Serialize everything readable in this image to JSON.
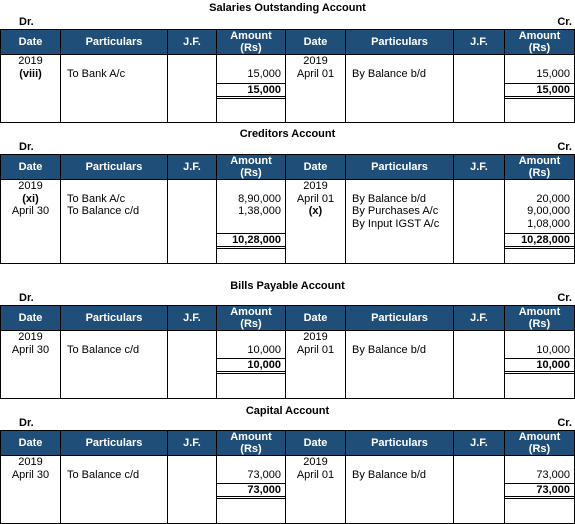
{
  "labels": {
    "dr": "Dr.",
    "cr": "Cr."
  },
  "columns": {
    "date": "Date",
    "particulars": "Particulars",
    "jf": "J.F.",
    "amount_1": "Amount",
    "amount_2": "(Rs)"
  },
  "accounts": [
    {
      "title": "Salaries  Outstanding Account",
      "debit": {
        "date": [
          "2019",
          "(viii)"
        ],
        "date_bold": [
          false,
          true
        ],
        "particulars": [
          "",
          "To Bank A/c"
        ],
        "amounts": [
          "",
          "15,000"
        ],
        "total": "15,000"
      },
      "credit": {
        "date": [
          "2019",
          "April 01"
        ],
        "date_bold": [
          false,
          false
        ],
        "particulars": [
          "",
          "By Balance b/d"
        ],
        "amounts": [
          "",
          "15,000"
        ],
        "total": "15,000"
      }
    },
    {
      "title": "Creditors Account",
      "debit": {
        "date": [
          "2019",
          "(xi)",
          "April 30"
        ],
        "date_bold": [
          false,
          true,
          false
        ],
        "particulars": [
          "",
          "To Bank A/c",
          "To Balance c/d"
        ],
        "amounts": [
          "",
          "8,90,000",
          "1,38,000"
        ],
        "total": "10,28,000"
      },
      "credit": {
        "date": [
          "2019",
          "April 01",
          "(x)"
        ],
        "date_bold": [
          false,
          false,
          true
        ],
        "particulars": [
          "",
          "By Balance b/d",
          "By Purchases A/c",
          "By Input IGST A/c"
        ],
        "amounts": [
          "",
          "20,000",
          "9,00,000",
          "1,08,000"
        ],
        "total": "10,28,000"
      }
    },
    {
      "title": "Bills Payable  Account",
      "debit": {
        "date": [
          "2019",
          "April 30"
        ],
        "date_bold": [
          false,
          false
        ],
        "particulars": [
          "",
          "To Balance c/d"
        ],
        "amounts": [
          "",
          "10,000"
        ],
        "total": "10,000"
      },
      "credit": {
        "date": [
          "2019",
          "April 01"
        ],
        "date_bold": [
          false,
          false
        ],
        "particulars": [
          "",
          "By Balance b/d"
        ],
        "amounts": [
          "",
          "10,000"
        ],
        "total": "10,000"
      }
    },
    {
      "title": "Capital Account",
      "debit": {
        "date": [
          "2019",
          "April 30"
        ],
        "date_bold": [
          false,
          false
        ],
        "particulars": [
          "",
          "To Balance c/d"
        ],
        "amounts": [
          "",
          "73,000"
        ],
        "total": "73,000"
      },
      "credit": {
        "date": [
          "2019",
          "April 01"
        ],
        "date_bold": [
          false,
          false
        ],
        "particulars": [
          "",
          "By Balance b/d"
        ],
        "amounts": [
          "",
          "73,000"
        ],
        "total": "73,000"
      }
    }
  ],
  "colors": {
    "header_bg": "#1f4e79",
    "header_text": "#ffffff"
  }
}
